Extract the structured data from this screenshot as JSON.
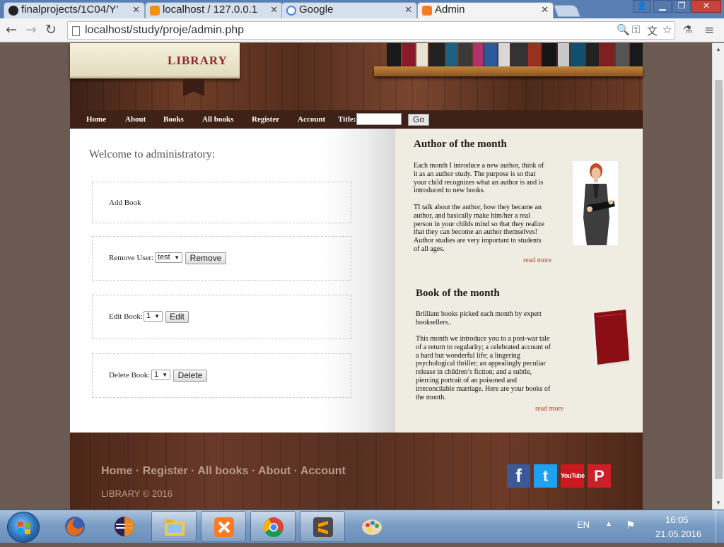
{
  "browser": {
    "tabs": [
      {
        "label": "finalprojects/1C04/Y’",
        "icon": "github-icon"
      },
      {
        "label": "localhost / 127.0.0.1",
        "icon": "phpmyadmin-icon"
      },
      {
        "label": "Google",
        "icon": "google-icon"
      },
      {
        "label": "Admin",
        "icon": "xampp-icon",
        "active": true
      }
    ],
    "url": "localhost/study/proje/admin.php"
  },
  "site": {
    "logo": "LIBRARY",
    "nav": [
      "Home",
      "About",
      "Books",
      "All books",
      "Register",
      "Account"
    ],
    "search_label": "Title:",
    "search_button": "Go"
  },
  "admin": {
    "welcome": "Welcome to administratory:",
    "add_book": "Add Book",
    "remove_user_label": "Remove User:",
    "remove_user_value": "test",
    "remove_button": "Remove",
    "edit_book_label": "Edit Book:",
    "edit_book_value": "1",
    "edit_button": "Edit",
    "delete_book_label": "Delete Book:",
    "delete_book_value": "1",
    "delete_button": "Delete"
  },
  "sidebar": {
    "author_title": "Author of the month",
    "author_lines_1": [
      "Each month I introduce a new author, think of",
      "it as an author study. The purpose is so that",
      "your child recognizes what an author is and is",
      "introduced to new books."
    ],
    "author_lines_2": [
      "TI talk about the author, how they became an",
      "author, and basically make him/her a real",
      "person in your childs mind so that they realize",
      "that they can become an author themselves!",
      "Author studies are very important to students",
      "of all ages."
    ],
    "author_read_more": "read more",
    "book_title": "Book of the month",
    "book_lines_1": [
      "Brilliant books picked each month by expert",
      "booksellers.."
    ],
    "book_lines_2": [
      "This month we introduce you to a post-war tale",
      "of a return to regularity; a celebrated account of",
      "a hard but wonderful life; a lingering",
      "psychological thriller; an appealingly peculiar",
      "release in children’s fiction; and a subtle,",
      "piercing portrait of an poisoned and",
      "irreconcilable marriage. Here are your books of",
      "the month."
    ],
    "book_read_more": "read more"
  },
  "footer": {
    "links": [
      "Home",
      "Register",
      "All books",
      "About",
      "Account"
    ],
    "separator": "·",
    "copyright": "LIBRARY © 2016",
    "social": [
      {
        "name": "facebook-icon",
        "glyph": "f",
        "color": "#3b5998"
      },
      {
        "name": "twitter-icon",
        "glyph": "t",
        "color": "#1da1f2"
      },
      {
        "name": "youtube-icon",
        "glyph": "YouTube",
        "color": "#cc181e"
      },
      {
        "name": "pinterest-icon",
        "glyph": "P",
        "color": "#cb2027"
      }
    ]
  },
  "taskbar": {
    "language": "EN",
    "time": "16:05",
    "date": "21.05.2016"
  },
  "colors": {
    "accent_link": "#b5452a",
    "logo_red": "#8b2a2a",
    "nav_bg": "#3e2218",
    "sidebar_bg": "#efece2"
  }
}
